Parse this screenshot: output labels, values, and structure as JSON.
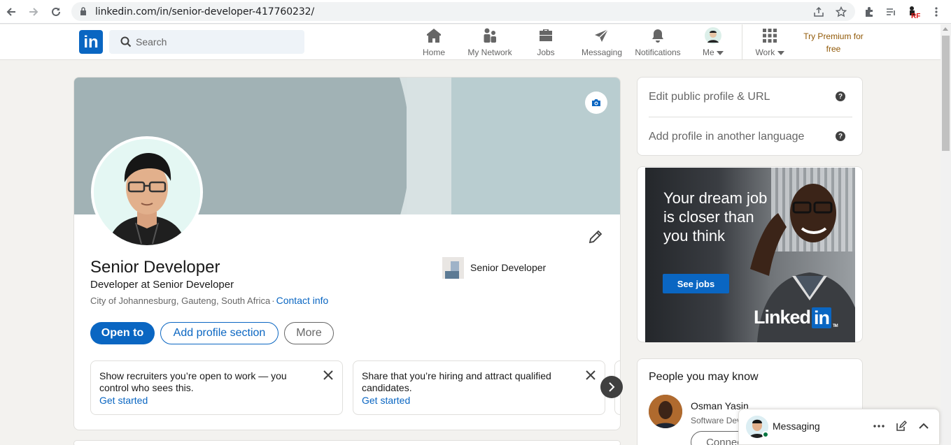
{
  "browser": {
    "url": "linkedin.com/in/senior-developer-417760232/"
  },
  "nav": {
    "logo": "in",
    "search_placeholder": "Search",
    "items": [
      {
        "label": "Home",
        "icon": "home-icon"
      },
      {
        "label": "My Network",
        "icon": "network-icon"
      },
      {
        "label": "Jobs",
        "icon": "briefcase-icon"
      },
      {
        "label": "Messaging",
        "icon": "send-icon"
      },
      {
        "label": "Notifications",
        "icon": "bell-icon"
      },
      {
        "label": "Me",
        "icon": "avatar"
      },
      {
        "label": "Work",
        "icon": "grid-icon"
      }
    ],
    "premium": "Try Premium for free"
  },
  "profile": {
    "name": "Senior Developer",
    "headline": "Developer at Senior Developer",
    "location": "City of Johannesburg, Gauteng, South Africa",
    "separator": "·",
    "contact_info": "Contact info",
    "company": "Senior Developer",
    "buttons": {
      "open_to": "Open to",
      "add_section": "Add profile section",
      "more": "More"
    },
    "tiles": [
      {
        "bold": "Show recruiters you’re open to work",
        "rest": " — you control who sees this.",
        "cta": "Get started"
      },
      {
        "bold": "Share that you’re hiring",
        "rest": " and attract qualified candidates.",
        "cta": "Get started"
      }
    ]
  },
  "sidebar": {
    "edit_url": "Edit public profile & URL",
    "add_language": "Add profile in another language",
    "help_glyph": "?"
  },
  "ad": {
    "copy": "Your dream job is closer than you think",
    "cta": "See jobs",
    "brand_text": "Linked",
    "brand_box": "in",
    "tm": "TM"
  },
  "pymk": {
    "heading": "People you may know",
    "person_name": "Osman Yasin",
    "person_title": "Software Dev",
    "connect": "Connect"
  },
  "messaging": {
    "label": "Messaging"
  },
  "colors": {
    "brand": "#0a66c2",
    "premium": "#915907",
    "online": "#057642"
  }
}
